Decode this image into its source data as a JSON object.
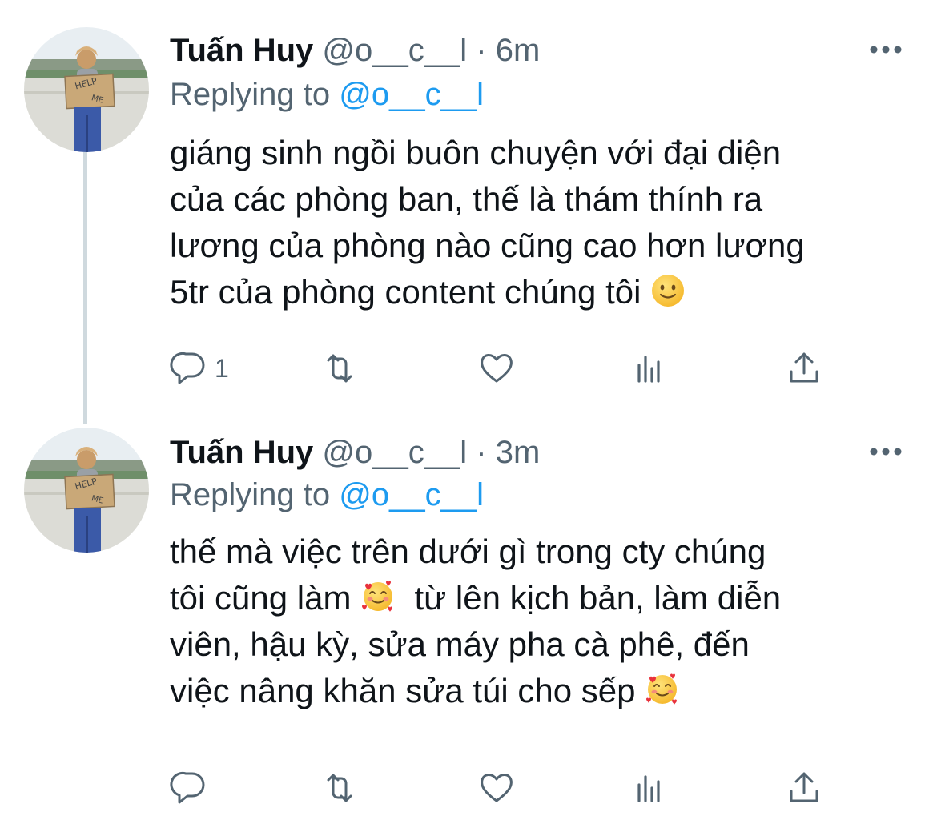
{
  "colors": {
    "text": "#0f1419",
    "secondary": "#536471",
    "link": "#1d9bf0",
    "thread": "#cfd9de"
  },
  "tweets": [
    {
      "author_name": "Tuấn Huy",
      "author_handle": "@o__c__l",
      "separator": "·",
      "time": "6m",
      "replying_prefix": "Replying to",
      "replying_to": "@o__c__l",
      "lines": [
        "giáng sinh ngồi buôn chuyện với đại diện",
        "của các phòng ban, thế là thám thính ra",
        "lương của phòng nào cũng cao hơn lương",
        "5tr của phòng content chúng tôi"
      ],
      "reply_count": "1",
      "avatar_sign": [
        "HELP",
        "ME"
      ]
    },
    {
      "author_name": "Tuấn Huy",
      "author_handle": "@o__c__l",
      "separator": "·",
      "time": "3m",
      "replying_prefix": "Replying to",
      "replying_to": "@o__c__l",
      "lines": [
        "thế mà việc trên dưới gì trong cty chúng",
        "tôi cũng làm",
        "từ lên kịch bản, làm diễn",
        "viên, hậu kỳ, sửa máy pha cà phê, đến",
        "việc nâng khăn sửa túi cho sếp"
      ],
      "reply_count": "",
      "avatar_sign": [
        "HELP",
        "ME"
      ]
    }
  ],
  "icons": {
    "more": "more-horizontal-icon",
    "reply": "reply-bubble-icon",
    "retweet": "retweet-icon",
    "like": "heart-icon",
    "views": "views-chart-icon",
    "share": "share-upload-icon",
    "emoji_1": "slightly-smiling-face-emoji",
    "emoji_2": "smiling-face-with-hearts-emoji"
  }
}
